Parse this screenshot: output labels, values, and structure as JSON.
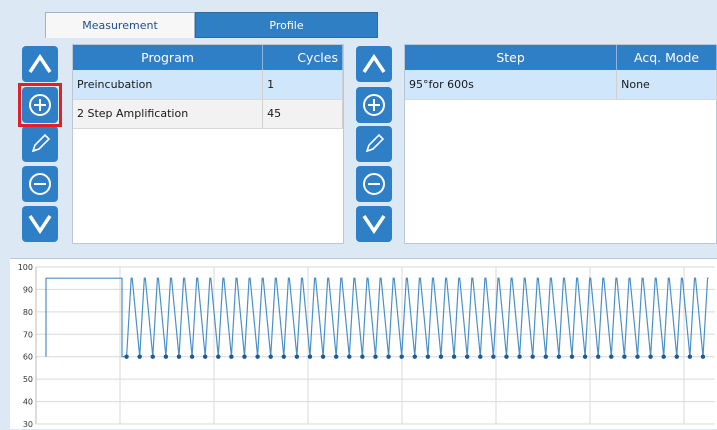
{
  "tabs": [
    {
      "label": "Measurement",
      "active": false
    },
    {
      "label": "Profile",
      "active": true
    }
  ],
  "program_table": {
    "columns": [
      "Program",
      "Cycles"
    ],
    "rows": [
      {
        "program": "Preincubation",
        "cycles": "1",
        "selected": true
      },
      {
        "program": "2 Step Amplification",
        "cycles": "45",
        "selected": false
      }
    ]
  },
  "step_table": {
    "columns": [
      "Step",
      "Acq. Mode"
    ],
    "rows": [
      {
        "step": "95°for 600s",
        "acq_mode": "None",
        "selected": true
      }
    ]
  },
  "toolbar_icons": [
    "arrow-up-icon",
    "add-circle-icon",
    "pencil-icon",
    "remove-circle-icon",
    "arrow-down-icon"
  ],
  "colors": {
    "accent": "#2f7fc6",
    "highlight": "#e0202a",
    "selected_row": "#cfe6fb",
    "trace": "#4a90c8"
  },
  "chart_data": {
    "type": "line",
    "title": "",
    "xlabel": "",
    "ylabel": "",
    "y_ticks": [
      100,
      90,
      80,
      70,
      60,
      50,
      40,
      30
    ],
    "y_tick_labels": [
      "100",
      "90",
      "80",
      "70",
      "60",
      "50",
      "40",
      "30"
    ],
    "ylim": [
      30,
      100
    ],
    "grid": true,
    "series": [
      {
        "preincubation_level": 95,
        "cycle_high": 95,
        "cycle_low": 60,
        "cycle_count": 45
      }
    ]
  }
}
